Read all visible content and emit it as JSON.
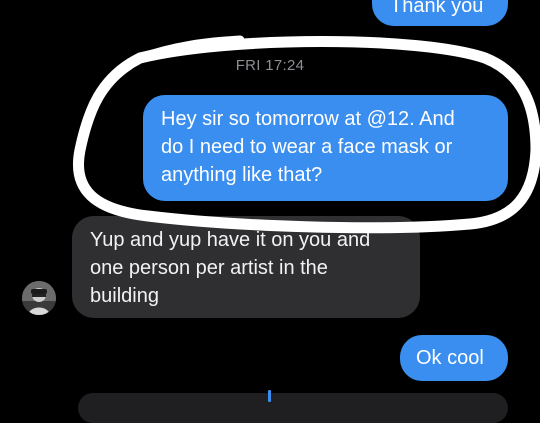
{
  "conversation": {
    "timestamp": "FRI 17:24",
    "messages": [
      {
        "sender": "me",
        "lines": [
          "Thank you"
        ]
      },
      {
        "sender": "me",
        "lines": [
          "Hey sir so tomorrow at @12. And",
          "do I need to wear a face mask or",
          "anything like that?"
        ]
      },
      {
        "sender": "them",
        "lines": [
          "Yup and yup have it on you and",
          "one person per artist in the",
          "building"
        ]
      },
      {
        "sender": "me",
        "lines": [
          "Ok cool"
        ]
      }
    ]
  },
  "colors": {
    "background": "#000000",
    "sent_bubble": "#3a8ef0",
    "received_bubble": "#2f2f31",
    "timestamp": "#8e8e93",
    "annotation_circle": "#ffffff"
  },
  "icons": [
    "avatar"
  ]
}
